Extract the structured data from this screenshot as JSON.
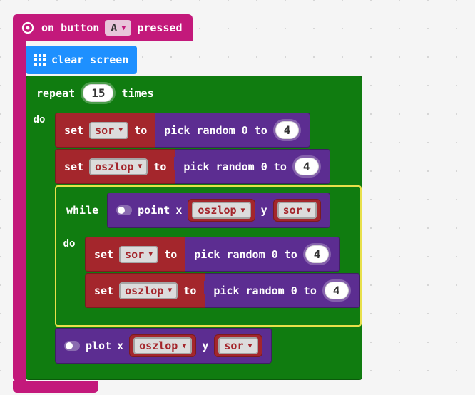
{
  "event": {
    "prefix": "on button",
    "button": "A",
    "suffix": "pressed"
  },
  "clearScreen": {
    "label": "clear screen"
  },
  "repeat": {
    "label": "repeat",
    "count": "15",
    "times": "times",
    "do": "do"
  },
  "vars": {
    "sor": "sor",
    "oszlop": "oszlop"
  },
  "set": {
    "label_set": "set",
    "label_to": "to"
  },
  "pick": {
    "prefix": "pick random 0 to",
    "limit": "4"
  },
  "while": {
    "label": "while",
    "do": "do"
  },
  "point": {
    "label": "point",
    "x": "x",
    "y": "y"
  },
  "plot": {
    "label": "plot",
    "x": "x",
    "y": "y"
  }
}
